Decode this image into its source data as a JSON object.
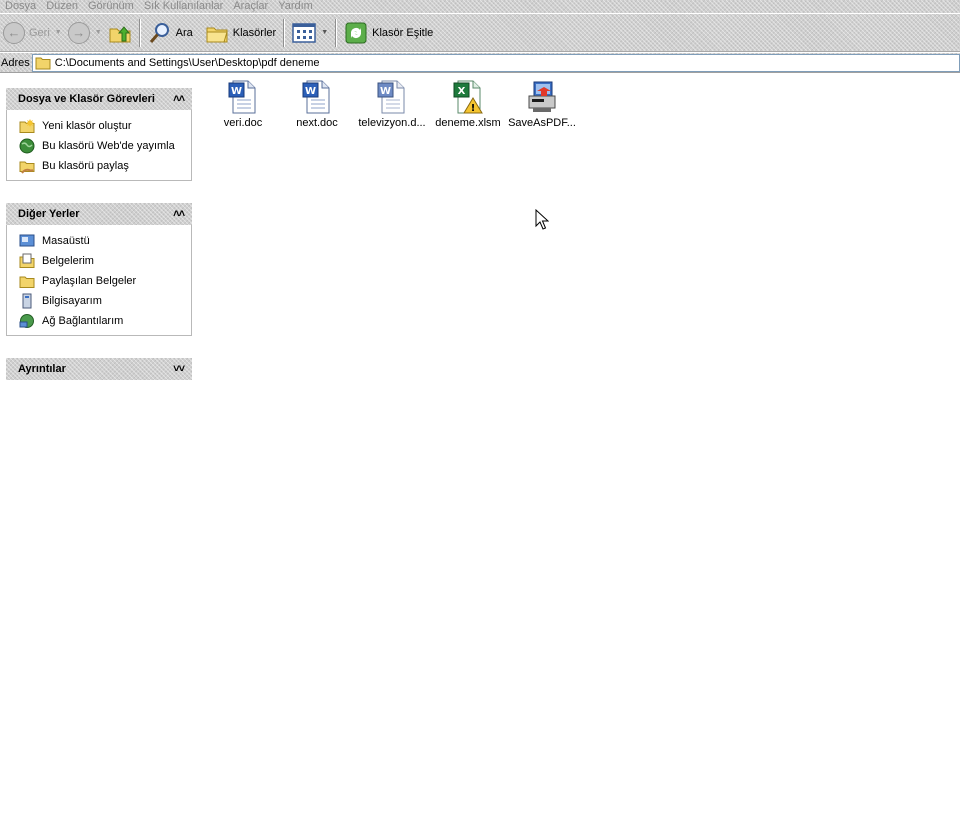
{
  "menu": {
    "items": [
      "Dosya",
      "Düzen",
      "Görünüm",
      "Sık Kullanılanlar",
      "Araçlar",
      "Yardım"
    ]
  },
  "toolbar": {
    "back_label": "Geri",
    "search_label": "Ara",
    "folders_label": "Klasörler",
    "sync_label": "Klasör Eşitle"
  },
  "address": {
    "label": "Adres",
    "path": "C:\\Documents and Settings\\User\\Desktop\\pdf deneme"
  },
  "task_pane": {
    "file_tasks": {
      "title": "Dosya ve Klasör Görevleri",
      "items": [
        "Yeni klasör oluştur",
        "Bu klasörü Web'de yayımla",
        "Bu klasörü paylaş"
      ]
    },
    "other_places": {
      "title": "Diğer Yerler",
      "items": [
        "Masaüstü",
        "Belgelerim",
        "Paylaşılan Belgeler",
        "Bilgisayarım",
        "Ağ Bağlantılarım"
      ]
    },
    "details": {
      "title": "Ayrıntılar"
    }
  },
  "files": [
    {
      "name": "veri.doc",
      "icon": "word-document-icon"
    },
    {
      "name": "next.doc",
      "icon": "word-document-icon"
    },
    {
      "name": "televizyon.d...",
      "icon": "word-document-icon"
    },
    {
      "name": "deneme.xlsm",
      "icon": "excel-macro-icon"
    },
    {
      "name": "SaveAsPDF...",
      "icon": "installer-icon"
    }
  ],
  "colors": {
    "word_blue": "#2b5fb8",
    "excel_green": "#1e7a3c",
    "folder_yellow": "#f2d46a"
  }
}
